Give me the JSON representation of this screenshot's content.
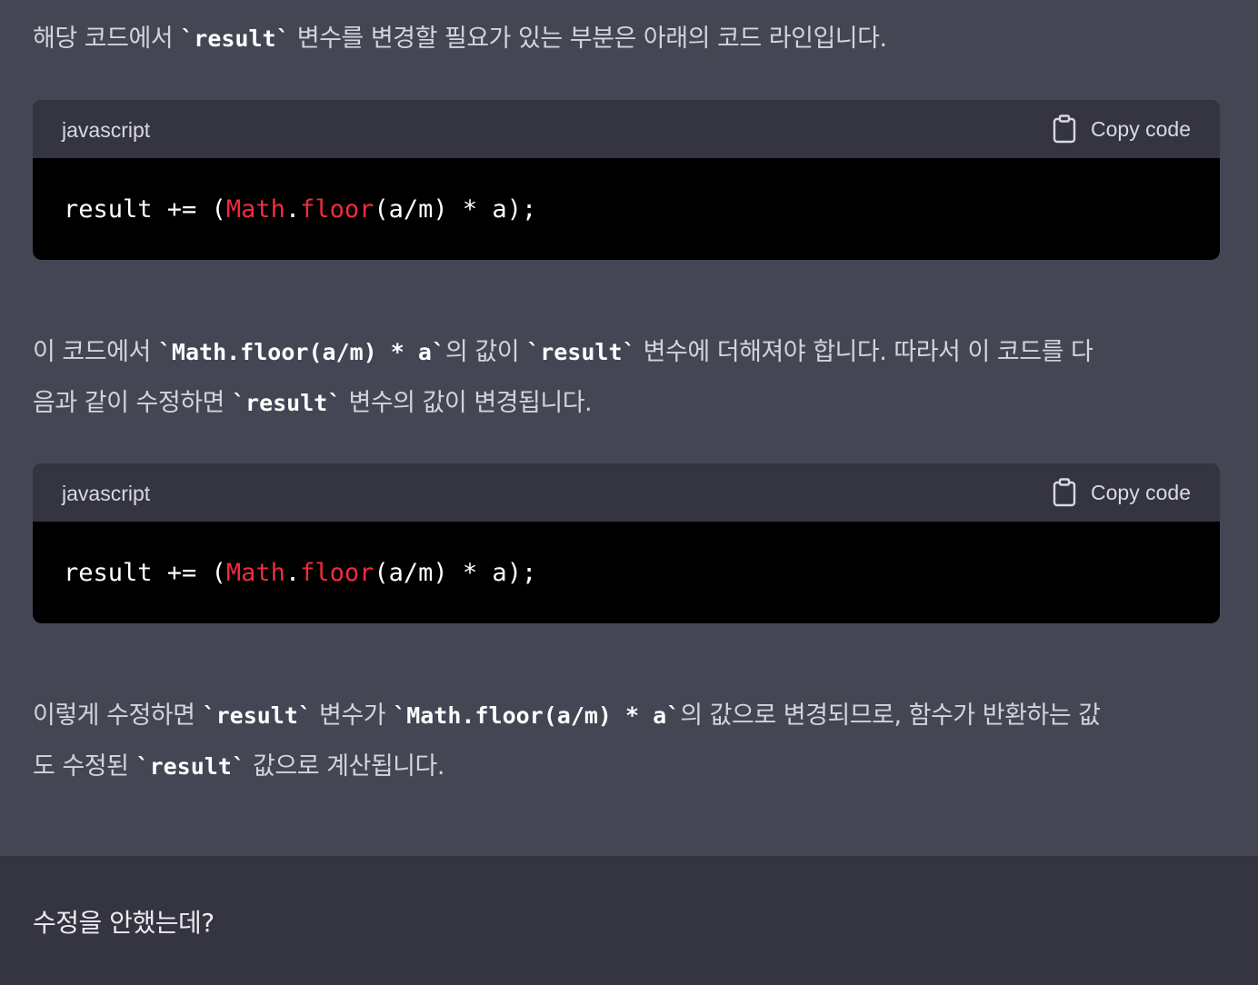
{
  "assistant": {
    "intro": {
      "t1": "해당 코드에서 ",
      "c1": "`result`",
      "t2": " 변수를 변경할 필요가 있는 부분은 아래의 코드 라인입니다."
    },
    "code_blocks": [
      {
        "language": "javascript",
        "copy_label": "Copy code",
        "code": {
          "p1": "result += (",
          "k1": "Math",
          "p2": ".",
          "k2": "floor",
          "p3": "(a/m) * a);"
        }
      },
      {
        "language": "javascript",
        "copy_label": "Copy code",
        "code": {
          "p1": "result += (",
          "k1": "Math",
          "p2": ".",
          "k2": "floor",
          "p3": "(a/m) * a);"
        }
      }
    ],
    "para2": {
      "line1": {
        "t1": "이 코드에서 ",
        "c1": "`Math.floor(a/m) * a`",
        "t2": "의 값이 ",
        "c2": "`result`",
        "t3": " 변수에 더해져야 합니다. 따라서 이 코드를 다"
      },
      "line2": {
        "t1": "음과 같이 수정하면 ",
        "c1": "`result`",
        "t2": " 변수의 값이 변경됩니다."
      }
    },
    "para3": {
      "line1": {
        "t1": "이렇게 수정하면 ",
        "c1": "`result`",
        "t2": " 변수가 ",
        "c2": "`Math.floor(a/m) * a`",
        "t3": "의 값으로 변경되므로, 함수가 반환하는 값"
      },
      "line2": {
        "t1": "도 수정된 ",
        "c1": "`result`",
        "t2": " 값으로 계산됩니다."
      }
    }
  },
  "user": {
    "message": "수정을 안했는데?"
  },
  "icons": {
    "copy": "clipboard-icon"
  },
  "colors": {
    "assistant_bg": "#444654",
    "user_bg": "#343541",
    "code_bg": "#000000",
    "code_header_bg": "#343541",
    "token_class": "#f22c3d"
  }
}
